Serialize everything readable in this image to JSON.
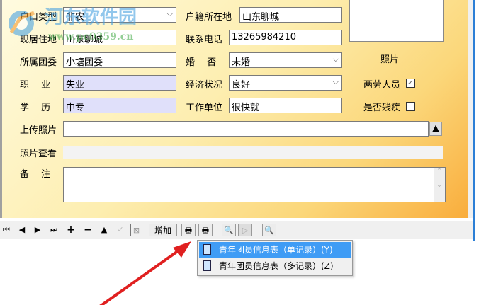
{
  "form": {
    "hukou_type": {
      "label": "户口类型",
      "value": "非农"
    },
    "huji": {
      "label": "户籍所在地",
      "value": "山东聊城"
    },
    "residence": {
      "label": "现居住地",
      "value": "山东聊城"
    },
    "phone": {
      "label": "联系电话",
      "value": "13265984210"
    },
    "league": {
      "label": "所属团委",
      "value": "小塘团委"
    },
    "marital": {
      "label": "婚　 否",
      "value": "未婚"
    },
    "occupation": {
      "label": "职　 业",
      "value": "失业"
    },
    "economy": {
      "label": "经济状况",
      "value": "良好"
    },
    "education": {
      "label": "学　 历",
      "value": "中专"
    },
    "workplace": {
      "label": "工作单位",
      "value": "很快就"
    },
    "photo_label": "照片",
    "lianglao": {
      "label": "两劳人员",
      "checked": true
    },
    "disabled": {
      "label": "是否残疾",
      "checked": false
    },
    "upload": {
      "label": "上传照片",
      "value": ""
    },
    "view": {
      "label": "照片查看"
    },
    "remark": {
      "label": "备　 注",
      "value": ""
    }
  },
  "toolbar": {
    "add_label": "增加"
  },
  "menu": {
    "items": [
      "青年团员信息表（单记录）(Y)",
      "青年团员信息表（多记录）(Z)"
    ]
  },
  "watermark": {
    "name": "河东软件园",
    "url": "www.pc0359.cn"
  },
  "colors": {
    "accent": "#3f9cf5",
    "arrow": "#e02020"
  }
}
